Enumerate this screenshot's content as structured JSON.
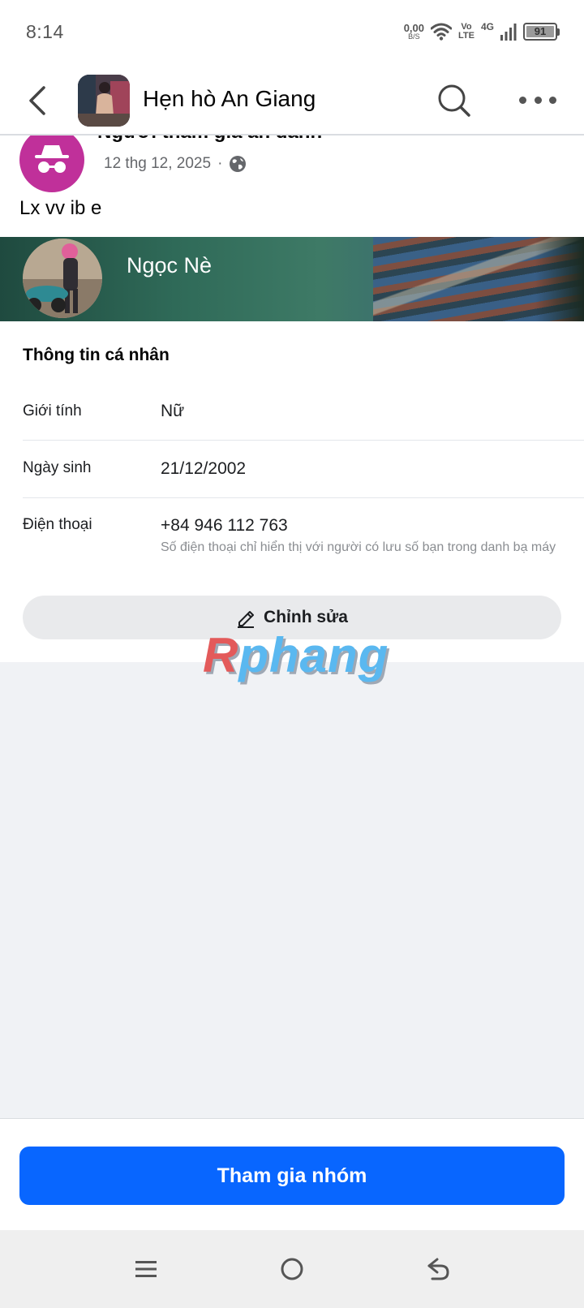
{
  "status_bar": {
    "time": "8:14",
    "net_speed_value": "0,00",
    "net_speed_unit": "B/S",
    "volte_top": "Vo",
    "volte_bottom": "LTE",
    "network": "4G",
    "battery": "91"
  },
  "header": {
    "title": "Hẹn hò An Giang"
  },
  "post": {
    "author": "Người tham gia ẩn danh",
    "date": "12 thg 12, 2025",
    "separator": "·",
    "text": "Lx vv ib e"
  },
  "profile": {
    "name": "Ngọc Nè"
  },
  "info": {
    "section_title": "Thông tin cá nhân",
    "gender_label": "Giới tính",
    "gender_value": "Nữ",
    "birthday_label": "Ngày sinh",
    "birthday_value": "21/12/2002",
    "phone_label": "Điện thoại",
    "phone_value": "+84 946 112 763",
    "phone_note": "Số điện thoại chỉ hiển thị với người có lưu số bạn trong danh bạ máy",
    "edit_label": "Chỉnh sửa"
  },
  "watermark": {
    "first": "R",
    "rest": "phang"
  },
  "join": {
    "label": "Tham gia nhóm"
  },
  "colors": {
    "accent": "#0866ff",
    "anon_avatar": "#c0309a"
  }
}
